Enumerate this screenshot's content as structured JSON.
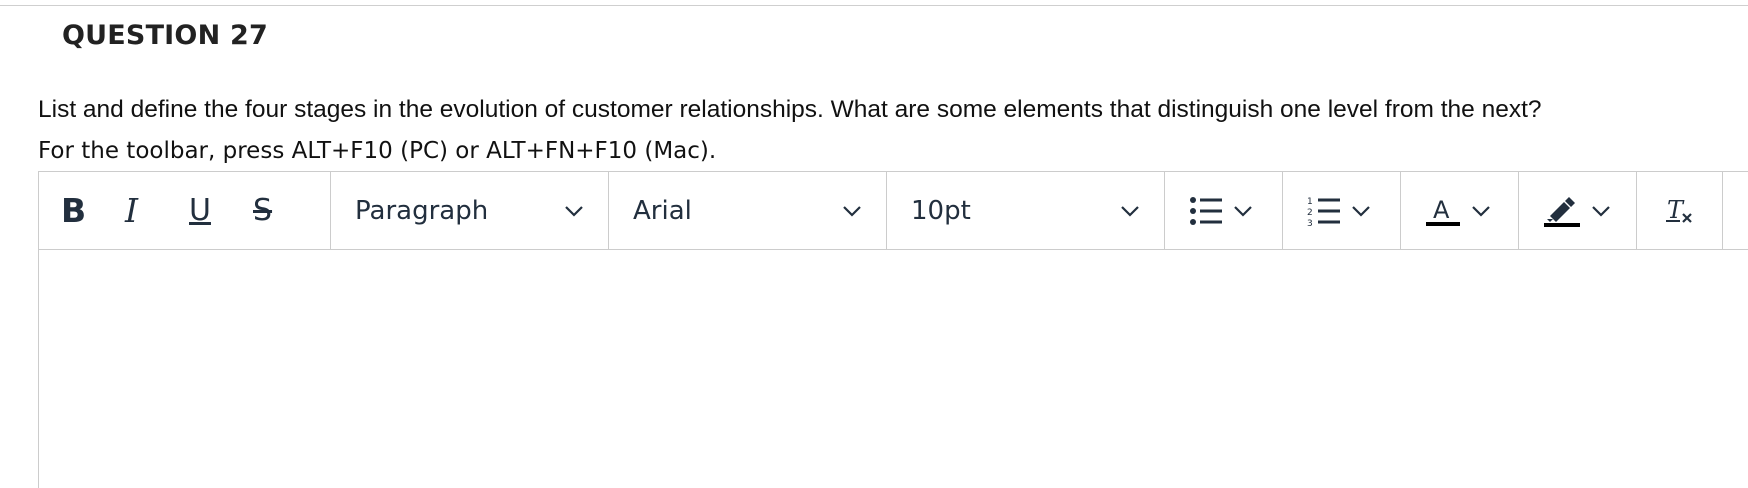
{
  "question": {
    "title": "QUESTION 27",
    "text": "List and define the four stages in the evolution of customer relationships. What are some elements that distinguish one level from the next?",
    "toolbar_hint": "For the toolbar, press ALT+F10 (PC) or ALT+FN+F10 (Mac)."
  },
  "toolbar": {
    "bold_glyph": "B",
    "italic_glyph": "I",
    "underline_glyph": "U",
    "strikethrough_glyph": "S",
    "block_format": "Paragraph",
    "font_family": "Arial",
    "font_size": "10pt",
    "icons": [
      "bold-icon",
      "italic-icon",
      "underline-icon",
      "strikethrough-icon",
      "chevron-down-icon",
      "bullet-list-icon",
      "numbered-list-icon",
      "text-color-icon",
      "highlight-icon",
      "clear-formatting-icon"
    ]
  },
  "editor": {
    "content": ""
  },
  "colors": {
    "icon": "#222f3e",
    "border": "#cccccc",
    "text": "#111111"
  }
}
